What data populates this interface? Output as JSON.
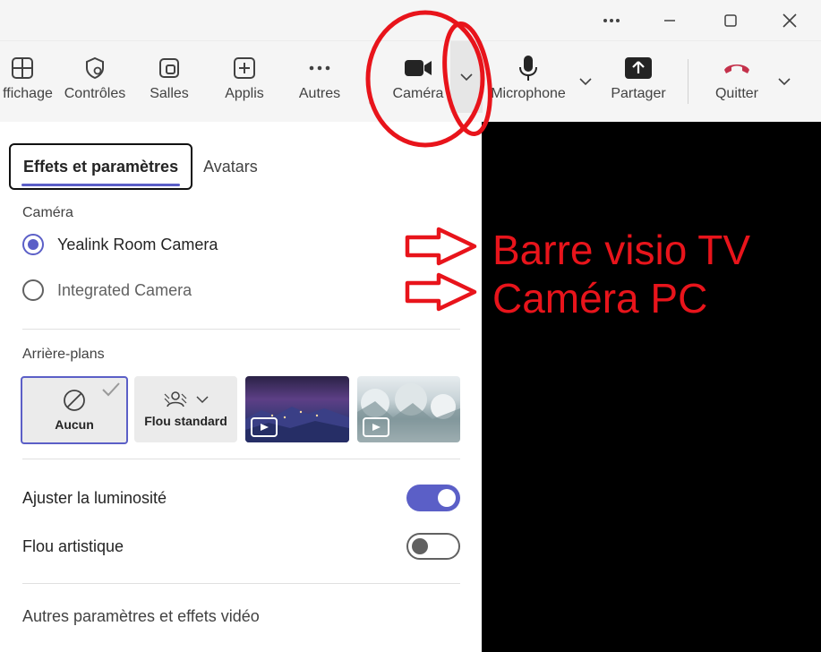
{
  "titlebar": {
    "more_icon": "ellipsis-icon",
    "minimize_icon": "minimize-icon",
    "maximize_icon": "maximize-icon",
    "close_icon": "close-icon"
  },
  "toolbar": {
    "items": [
      {
        "label": "ffichage",
        "icon": "grid-icon"
      },
      {
        "label": "Contrôles",
        "icon": "shield-gear-icon"
      },
      {
        "label": "Salles",
        "icon": "rooms-icon"
      },
      {
        "label": "Applis",
        "icon": "add-app-icon"
      },
      {
        "label": "Autres",
        "icon": "more-icon"
      },
      {
        "label": "Caméra",
        "icon": "video-camera-icon"
      },
      {
        "label": "Microphone",
        "icon": "microphone-icon"
      },
      {
        "label": "Partager",
        "icon": "share-icon"
      },
      {
        "label": "Quitter",
        "icon": "hang-up-icon"
      }
    ]
  },
  "panel": {
    "tabs": {
      "active": "Effets et paramètres",
      "other": "Avatars"
    },
    "camera_section": "Caméra",
    "cameras": [
      {
        "label": "Yealink Room Camera",
        "selected": true
      },
      {
        "label": "Integrated Camera",
        "selected": false
      }
    ],
    "backgrounds_section": "Arrière-plans",
    "backgrounds": {
      "none_label": "Aucun",
      "blur_label": "Flou standard"
    },
    "toggles": [
      {
        "label": "Ajuster la luminosité",
        "on": true
      },
      {
        "label": "Flou artistique",
        "on": false
      }
    ],
    "more_settings": "Autres paramètres et effets vidéo"
  },
  "annotations": {
    "line1": "Barre visio TV",
    "line2": "Caméra PC"
  },
  "colors": {
    "accent": "#5b5fc7",
    "annotation_red": "#e8141b",
    "hangup_red": "#c4314b"
  }
}
